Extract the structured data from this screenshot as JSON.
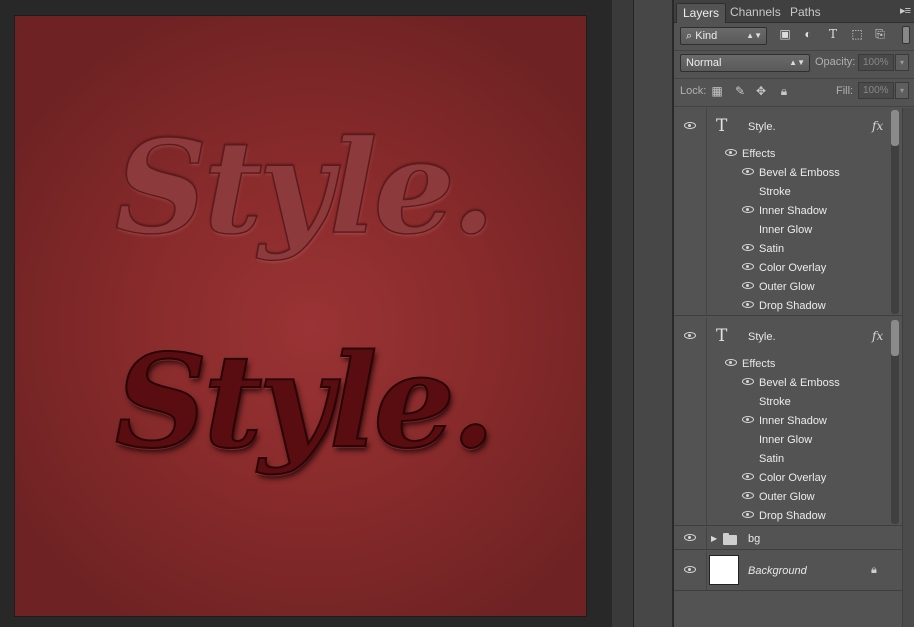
{
  "canvas": {
    "text_top": "Style.",
    "text_bottom": "Style."
  },
  "panel": {
    "tabs": [
      {
        "label": "Layers",
        "active": true
      },
      {
        "label": "Channels",
        "active": false
      },
      {
        "label": "Paths",
        "active": false
      }
    ],
    "filter": {
      "kind_label": "Kind",
      "icons": [
        "image-filter-icon",
        "adjustment-filter-icon",
        "type-filter-icon",
        "shape-filter-icon",
        "smart-object-filter-icon"
      ]
    },
    "blend": {
      "mode": "Normal",
      "opacity_label": "Opacity:",
      "opacity_value": "100%"
    },
    "lock": {
      "label": "Lock:",
      "fill_label": "Fill:",
      "fill_value": "100%"
    },
    "layers": [
      {
        "name": "Style.",
        "type": "text",
        "fx": "fx",
        "effects_label": "Effects",
        "effects": [
          {
            "name": "Bevel & Emboss",
            "visible": true
          },
          {
            "name": "Stroke",
            "visible": false
          },
          {
            "name": "Inner Shadow",
            "visible": true
          },
          {
            "name": "Inner Glow",
            "visible": false
          },
          {
            "name": "Satin",
            "visible": true
          },
          {
            "name": "Color Overlay",
            "visible": true
          },
          {
            "name": "Outer Glow",
            "visible": true
          },
          {
            "name": "Drop Shadow",
            "visible": true
          }
        ]
      },
      {
        "name": "Style.",
        "type": "text",
        "fx": "fx",
        "effects_label": "Effects",
        "effects": [
          {
            "name": "Bevel & Emboss",
            "visible": true
          },
          {
            "name": "Stroke",
            "visible": false
          },
          {
            "name": "Inner Shadow",
            "visible": true
          },
          {
            "name": "Inner Glow",
            "visible": false
          },
          {
            "name": "Satin",
            "visible": false
          },
          {
            "name": "Color Overlay",
            "visible": true
          },
          {
            "name": "Outer Glow",
            "visible": true
          },
          {
            "name": "Drop Shadow",
            "visible": true
          }
        ]
      },
      {
        "name": "bg",
        "type": "group"
      },
      {
        "name": "Background",
        "type": "background",
        "locked": true
      }
    ]
  },
  "colors": {
    "canvas_bg": "#8a2b2c",
    "panel_bg": "#535353",
    "workspace_bg": "#282828"
  }
}
